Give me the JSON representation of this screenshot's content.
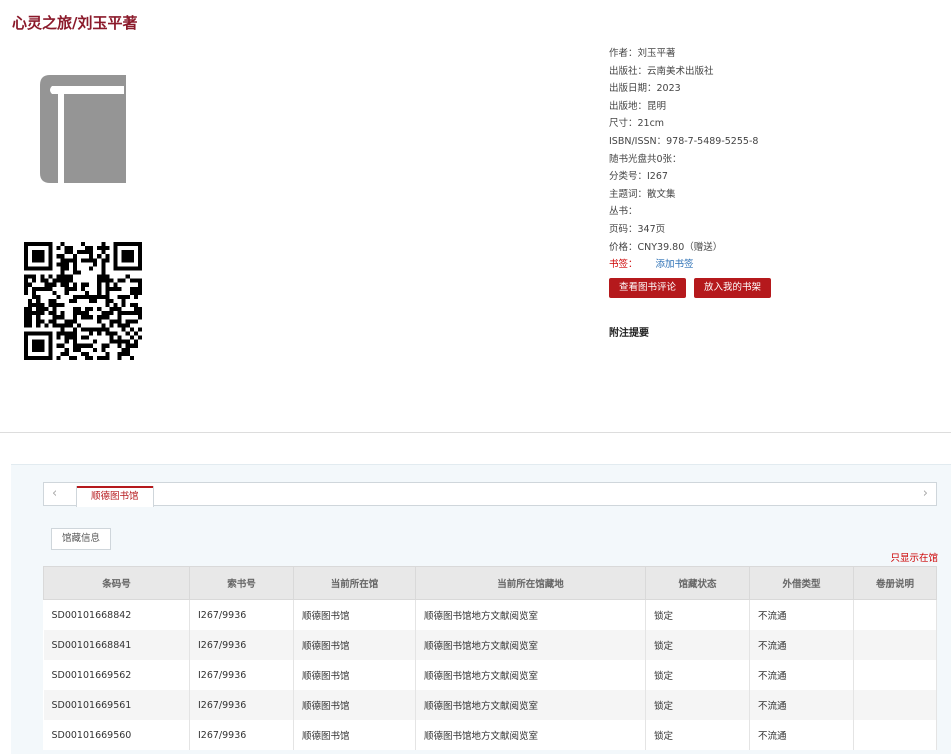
{
  "title": "心灵之旅/刘玉平著",
  "meta": [
    "作者：刘玉平著",
    "出版社：云南美术出版社",
    "出版日期：2023",
    "出版地：昆明",
    "尺寸：21cm",
    "ISBN/ISSN：978-7-5489-5255-8",
    "随书光盘共0张：",
    "分类号：I267",
    "主题词：散文集",
    "丛书：",
    "页码：347页",
    "价格：CNY39.80（赠送）"
  ],
  "bookmark": {
    "label": "书签：",
    "link": "添加书签"
  },
  "buttons": {
    "review": "查看图书评论",
    "shelf": "放入我的书架"
  },
  "note_heading": "附注提要",
  "tabs": {
    "library": "顺德图书馆",
    "holdings": "馆藏信息",
    "only_show": "只显示在馆"
  },
  "icons": {
    "left": "chevron-left-icon",
    "right": "chevron-right-icon",
    "cover": "book-icon",
    "qr": "qr-code-icon"
  },
  "table": {
    "headers": [
      "条码号",
      "索书号",
      "当前所在馆",
      "当前所在馆藏地",
      "馆藏状态",
      "外借类型",
      "卷册说明"
    ],
    "rows": [
      [
        "SD00101668842",
        "I267/9936",
        "顺德图书馆",
        "顺德图书馆地方文献阅览室",
        "锁定",
        "不流通",
        ""
      ],
      [
        "SD00101668841",
        "I267/9936",
        "顺德图书馆",
        "顺德图书馆地方文献阅览室",
        "锁定",
        "不流通",
        ""
      ],
      [
        "SD00101669562",
        "I267/9936",
        "顺德图书馆",
        "顺德图书馆地方文献阅览室",
        "锁定",
        "不流通",
        ""
      ],
      [
        "SD00101669561",
        "I267/9936",
        "顺德图书馆",
        "顺德图书馆地方文献阅览室",
        "锁定",
        "不流通",
        ""
      ],
      [
        "SD00101669560",
        "I267/9936",
        "顺德图书馆",
        "顺德图书馆地方文献阅览室",
        "锁定",
        "不流通",
        ""
      ]
    ]
  }
}
